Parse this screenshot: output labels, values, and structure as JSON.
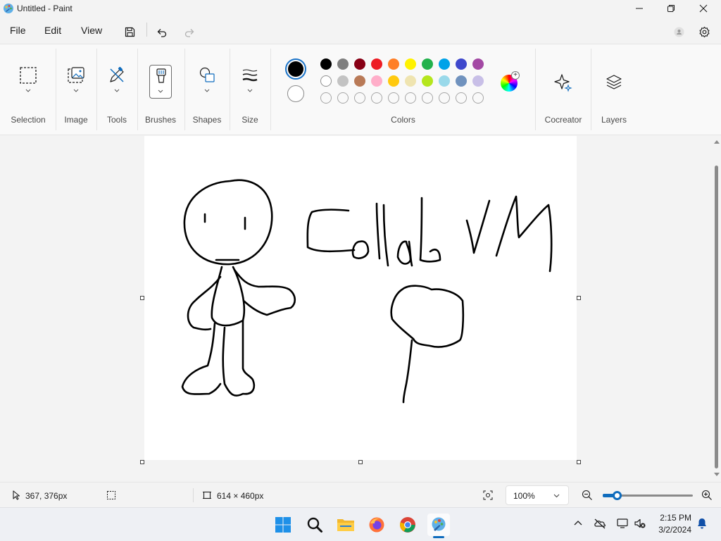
{
  "window": {
    "title": "Untitled - Paint",
    "icons": [
      "paint-app-icon",
      "minimize-icon",
      "restore-icon",
      "close-icon"
    ]
  },
  "menu": {
    "file": "File",
    "edit": "Edit",
    "view": "View",
    "quick_actions": [
      "save-icon",
      "undo-icon",
      "redo-icon"
    ],
    "right_icons": [
      "account-icon",
      "settings-gear-icon"
    ]
  },
  "ribbon": {
    "groups": {
      "selection": "Selection",
      "image": "Image",
      "tools": "Tools",
      "brushes": "Brushes",
      "shapes": "Shapes",
      "size": "Size",
      "colors": "Colors",
      "cocreator": "Cocreator",
      "layers": "Layers"
    },
    "primary_color": "#000000",
    "secondary_color": "#ffffff",
    "palette_row1": [
      "#000000",
      "#7f7f7f",
      "#880015",
      "#ed1c24",
      "#ff7f27",
      "#fff200",
      "#22b14c",
      "#00a2e8",
      "#3f48cc",
      "#a349a4"
    ],
    "palette_row2": [
      "#ffffff",
      "#c3c3c3",
      "#b97a57",
      "#ffaec9",
      "#ffc90e",
      "#efe4b0",
      "#b5e61d",
      "#99d9ea",
      "#7092be",
      "#c8bfe7"
    ],
    "palette_row3_empty_count": 10
  },
  "canvas": {
    "background": "#ffffff",
    "drawing_text": "Collab VM"
  },
  "status": {
    "cursor_position": "367, 376px",
    "canvas_size": "614 × 460px",
    "zoom": "100%",
    "zoom_fraction": 0.1
  },
  "taskbar": {
    "apps": [
      "windows-start-icon",
      "search-icon",
      "file-explorer-icon",
      "firefox-icon",
      "chrome-icon",
      "paint-icon"
    ],
    "active_app": "paint-icon",
    "tray": [
      "chevron-up-icon",
      "onedrive-offline-icon",
      "display-icon",
      "speaker-muted-icon",
      "notification-bell-icon"
    ],
    "time": "2:15 PM",
    "date": "3/2/2024"
  }
}
